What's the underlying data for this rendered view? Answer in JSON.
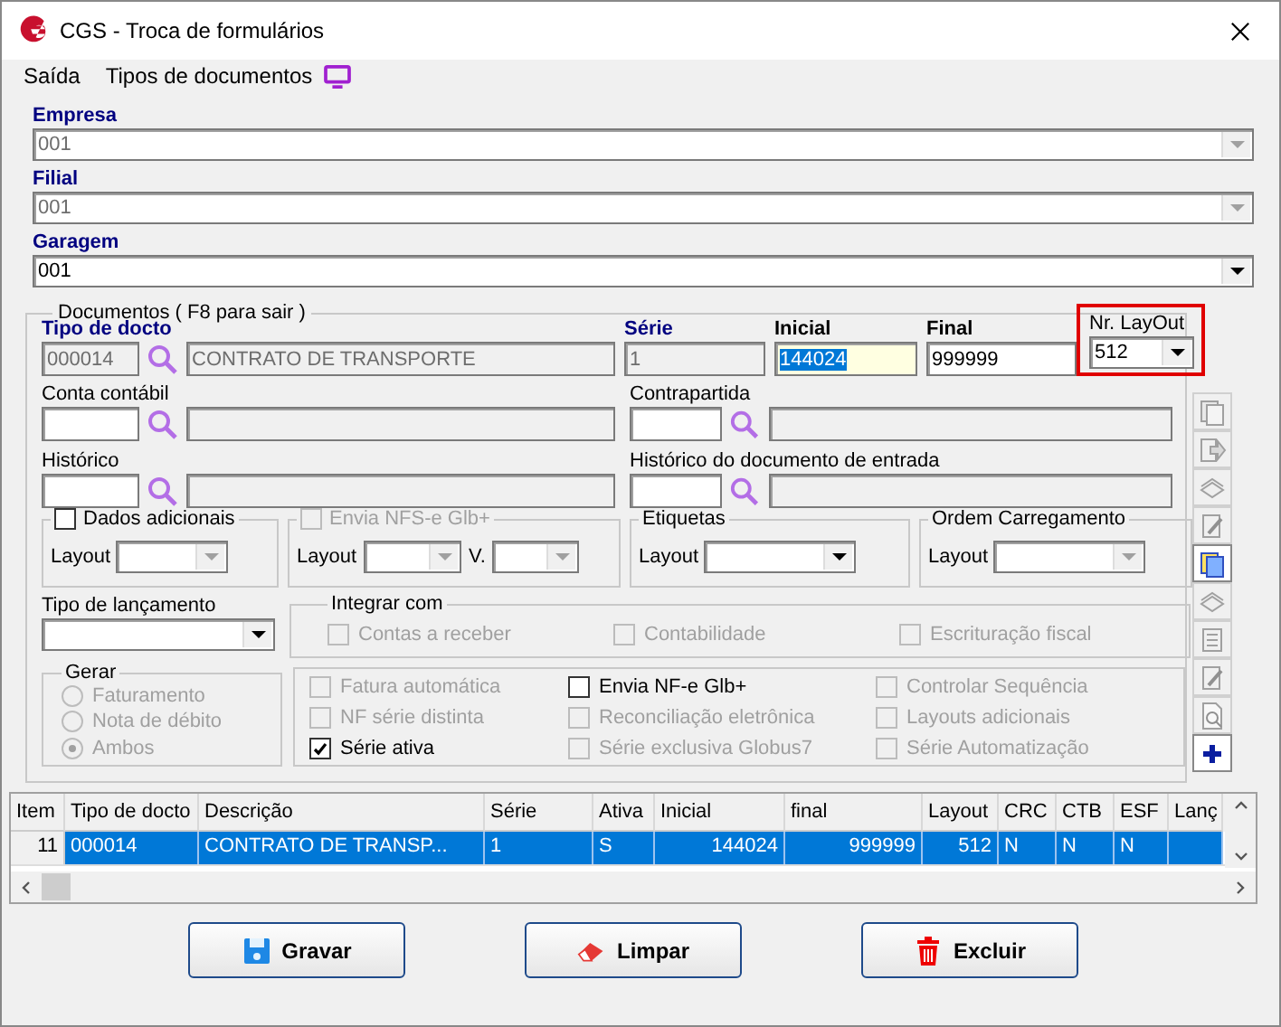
{
  "window": {
    "title": "CGS - Troca de formulários"
  },
  "menu": [
    "Saída",
    "Tipos de documentos"
  ],
  "company_fields": [
    {
      "label": "Empresa",
      "value": "001",
      "disabled": true
    },
    {
      "label": "Filial",
      "value": "001",
      "disabled": true
    },
    {
      "label": "Garagem",
      "value": "001",
      "disabled": false
    }
  ],
  "documentos": {
    "title": "Documentos ( F8 para sair )",
    "tipo_docto": {
      "label": "Tipo de docto",
      "code": "000014",
      "description": "CONTRATO DE TRANSPORTE"
    },
    "serie": {
      "label": "Série",
      "value": "1"
    },
    "inicial": {
      "label": "Inicial",
      "value": "144024"
    },
    "final": {
      "label": "Final",
      "value": "999999"
    },
    "layout": {
      "label": "Nr. LayOut",
      "value": "512"
    },
    "lookups": [
      {
        "label": "Conta contábil"
      },
      {
        "label": "Contrapartida"
      },
      {
        "label": "Histórico"
      },
      {
        "label": "Histórico do documento de entrada"
      }
    ],
    "dados_adicionais": {
      "label": "Dados adicionais",
      "checked": false,
      "disabled": false,
      "layout_label": "Layout"
    },
    "nfse": {
      "label": "Envia NFS-e Glb+",
      "checked": false,
      "disabled": true,
      "layout_label": "Layout",
      "version_label": "V."
    },
    "etiquetas": {
      "title": "Etiquetas",
      "layout_label": "Layout",
      "disabled": false
    },
    "ordem": {
      "title": "Ordem Carregamento",
      "layout_label": "Layout",
      "disabled": true
    },
    "tipo_lancamento": {
      "label": "Tipo de lançamento"
    },
    "integrar": {
      "title": "Integrar com",
      "options": [
        {
          "label": "Contas a receber",
          "checked": false,
          "disabled": true
        },
        {
          "label": "Contabilidade",
          "checked": false,
          "disabled": true
        },
        {
          "label": "Escrituração fiscal",
          "checked": false,
          "disabled": true
        }
      ]
    },
    "gerar": {
      "title": "Gerar",
      "options": [
        {
          "label": "Faturamento",
          "selected": false,
          "disabled": true
        },
        {
          "label": "Nota de débito",
          "selected": false,
          "disabled": true
        },
        {
          "label": "Ambos",
          "selected": true,
          "disabled": true
        }
      ]
    },
    "flags": [
      {
        "label": "Fatura automática",
        "checked": false,
        "disabled": true
      },
      {
        "label": "Envia NF-e Glb+",
        "checked": false,
        "disabled": false
      },
      {
        "label": "Controlar Sequência",
        "checked": false,
        "disabled": true
      },
      {
        "label": "NF série distinta",
        "checked": false,
        "disabled": true
      },
      {
        "label": "Reconciliação eletrônica",
        "checked": false,
        "disabled": true
      },
      {
        "label": "Layouts adicionais",
        "checked": false,
        "disabled": true
      },
      {
        "label": "Série ativa",
        "checked": true,
        "disabled": false
      },
      {
        "label": "Série exclusiva Globus7",
        "checked": false,
        "disabled": true
      },
      {
        "label": "Série Automatização",
        "checked": false,
        "disabled": true
      }
    ]
  },
  "toolbar": [
    {
      "kind": "pages",
      "disabled": true
    },
    {
      "kind": "export",
      "disabled": true
    },
    {
      "kind": "stack",
      "disabled": true
    },
    {
      "kind": "edit",
      "disabled": true
    },
    {
      "kind": "pages",
      "disabled": false
    },
    {
      "kind": "stack",
      "disabled": true
    },
    {
      "kind": "list",
      "disabled": true
    },
    {
      "kind": "edit",
      "disabled": true
    },
    {
      "kind": "preview",
      "disabled": true
    },
    {
      "kind": "add",
      "disabled": false
    }
  ],
  "table": {
    "columns": [
      {
        "label": "Item",
        "numeric": true
      },
      {
        "label": "Tipo de docto",
        "numeric": false
      },
      {
        "label": "Descrição",
        "numeric": false
      },
      {
        "label": "Série",
        "numeric": false
      },
      {
        "label": "Ativa",
        "numeric": false
      },
      {
        "label": "Inicial",
        "numeric": true
      },
      {
        "label": "final",
        "numeric": true
      },
      {
        "label": "Layout",
        "numeric": true
      },
      {
        "label": "CRC",
        "numeric": false
      },
      {
        "label": "CTB",
        "numeric": false
      },
      {
        "label": "ESF",
        "numeric": false
      },
      {
        "label": "Lanç"
      }
    ],
    "rows": [
      {
        "selected": true,
        "cells": [
          "11",
          "000014",
          "CONTRATO DE TRANSP...",
          "1",
          "S",
          "144024",
          "999999",
          "512",
          "N",
          "N",
          "N"
        ]
      }
    ]
  },
  "buttons": [
    {
      "label": "Gravar",
      "kind": "save"
    },
    {
      "label": "Limpar",
      "kind": "clear"
    },
    {
      "label": "Excluir",
      "kind": "delete"
    }
  ]
}
